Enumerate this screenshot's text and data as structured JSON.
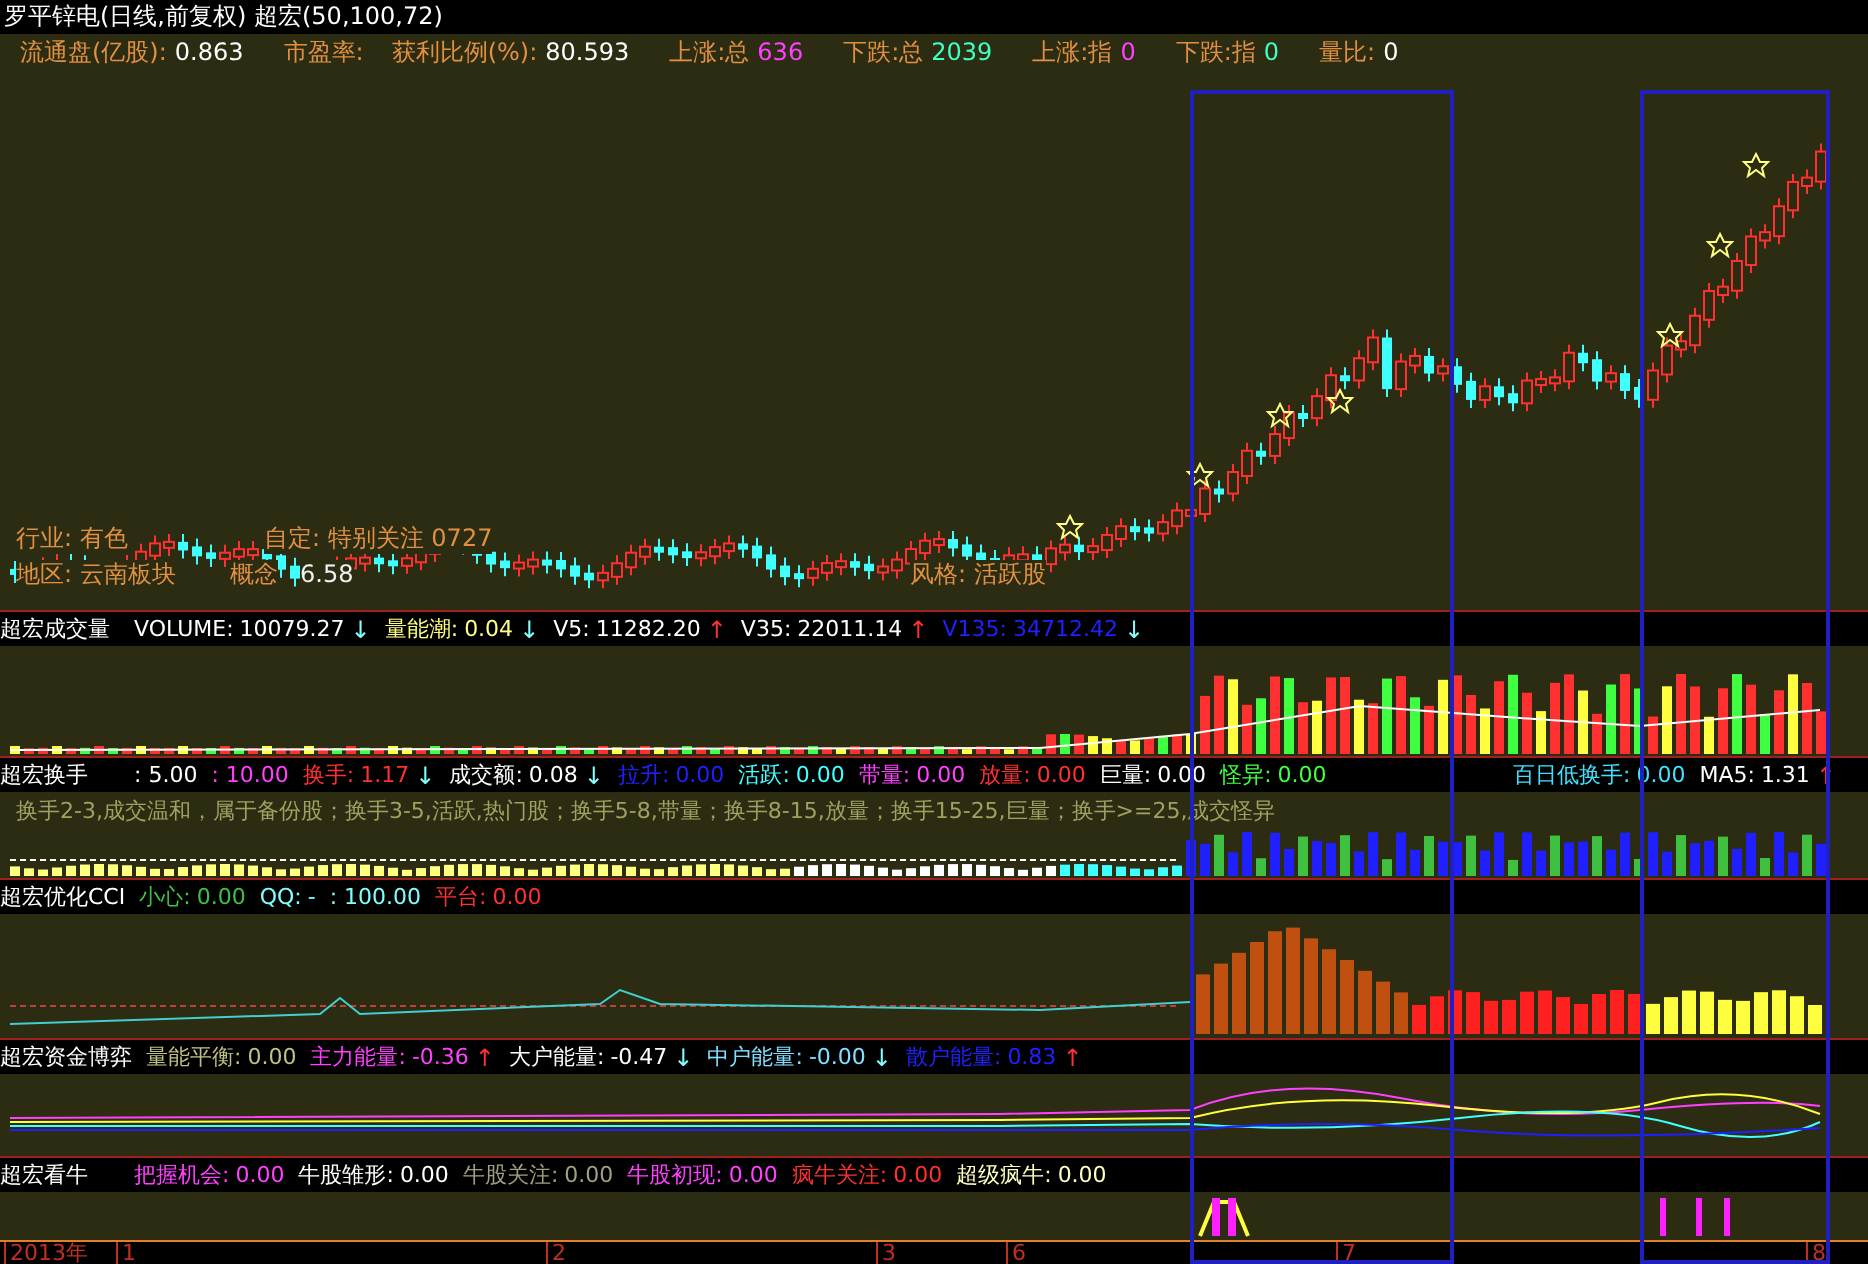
{
  "window": {
    "title": "罗平锌电(日线,前复权) 超宏(50,100,72)"
  },
  "header": [
    {
      "label": "流通盘(亿股):",
      "value": "0.863",
      "color": "#ffffff"
    },
    {
      "label": "市盈率:"
    },
    {
      "label": "获利比例(%):",
      "value": "80.593",
      "color": "#ffffff"
    },
    {
      "label": "上涨:总",
      "value": "636",
      "color": "#ff40ff"
    },
    {
      "label": "下跌:总",
      "value": "2039",
      "color": "#40ffc0"
    },
    {
      "label": "上涨:指",
      "value": "0",
      "color": "#ff40ff"
    },
    {
      "label": "下跌:指",
      "value": "0",
      "color": "#40ffc0"
    },
    {
      "label": "量比:",
      "value": "0",
      "color": "#ffffff"
    }
  ],
  "main_chart": {
    "notes": [
      "行业: 有色",
      "自定: 特别关注 0727",
      "地区: 云南板块",
      "概念",
      "风格: 活跃股"
    ],
    "low_price": "6.58"
  },
  "panels": [
    {
      "kind": "volume",
      "title": "超宏成交量",
      "items": [
        {
          "label": "VOLUME:",
          "value": "10079.27",
          "color": "#ffffff",
          "arrow": "↓",
          "rising": false
        },
        {
          "label": "量能潮:",
          "value": "0.04",
          "color": "#ffff80",
          "arrow": "↓",
          "rising": false
        },
        {
          "label": "V5:",
          "value": "11282.20",
          "color": "#ffffff",
          "arrow": "↑",
          "rising": true
        },
        {
          "label": "V35:",
          "value": "22011.14",
          "color": "#ffffff",
          "arrow": "↑",
          "rising": true
        },
        {
          "label": "V135:",
          "value": "34712.42",
          "color": "#2020ff",
          "arrow": "↓",
          "rising": false
        }
      ]
    },
    {
      "kind": "turnover",
      "title": "超宏换手",
      "items": [
        {
          "value": ": 5.00",
          "color": "#ffffff"
        },
        {
          "value": ": 10.00",
          "color": "#ff40ff"
        },
        {
          "label": "换手:",
          "value": "1.17",
          "color": "#ff3030",
          "arrow": "↓",
          "rising": false
        },
        {
          "label": "成交额:",
          "value": "0.08",
          "color": "#ffffff",
          "arrow": "↓",
          "rising": false
        },
        {
          "label": "拉升:",
          "value": "0.00",
          "color": "#2020ff"
        },
        {
          "label": "活跃:",
          "value": "0.00",
          "color": "#40ffff"
        },
        {
          "label": "带量:",
          "value": "0.00",
          "color": "#ff40ff"
        },
        {
          "label": "放量:",
          "value": "0.00",
          "color": "#ff3030"
        },
        {
          "label": "巨量:",
          "value": "0.00",
          "color": "#ffffff"
        },
        {
          "label": "怪异:",
          "value": "0.00",
          "color": "#40ff40"
        }
      ],
      "right_items": [
        {
          "label": "百日低换手:",
          "value": "0.00",
          "color": "#40e0ff"
        },
        {
          "label": "MA5:",
          "value": "1.31",
          "color": "#ffffff",
          "arrow": "↑",
          "rising": true
        }
      ],
      "note": "换手2-3,成交温和，属于备份股；换手3-5,活跃,热门股；换手5-8,带量；换手8-15,放量；换手15-25,巨量；换手>=25,成交怪异"
    },
    {
      "kind": "cci",
      "title": "超宏优化CCI",
      "items": [
        {
          "label": "小心:",
          "value": "0.00",
          "color": "#40c040"
        },
        {
          "label": "QQ:",
          "value": "-",
          "color": "#80ffff"
        },
        {
          "value": ": 100.00",
          "color": "#80ffff"
        },
        {
          "label": "平台:",
          "value": "0.00",
          "color": "#ff3030"
        }
      ]
    },
    {
      "kind": "capital",
      "title": "超宏资金博弈",
      "items": [
        {
          "label": "量能平衡:",
          "value": "0.00",
          "color": "#c0c080"
        },
        {
          "label": "主力能量:",
          "value": "-0.36",
          "color": "#ff40ff",
          "arrow": "↑",
          "rising": true
        },
        {
          "label": "大户能量:",
          "value": "-0.47",
          "color": "#ffffff",
          "arrow": "↓",
          "rising": false
        },
        {
          "label": "中户能量:",
          "value": "-0.00",
          "color": "#80e0ff",
          "arrow": "↓",
          "rising": false
        },
        {
          "label": "散户能量:",
          "value": "0.83",
          "color": "#2020ff",
          "arrow": "↑",
          "rising": true
        }
      ]
    },
    {
      "kind": "bull",
      "title": "超宏看牛",
      "items": [
        {
          "label": "把握机会:",
          "value": "0.00",
          "color": "#ff40ff"
        },
        {
          "label": "牛股雏形:",
          "value": "0.00",
          "color": "#ffffff"
        },
        {
          "label": "牛股关注:",
          "value": "0.00",
          "color": "#a0a080"
        },
        {
          "label": "牛股初现:",
          "value": "0.00",
          "color": "#ff40ff"
        },
        {
          "label": "疯牛关注:",
          "value": "0.00",
          "color": "#ff3030"
        },
        {
          "label": "超级疯牛:",
          "value": "0.00",
          "color": "#ffffc0"
        }
      ]
    }
  ],
  "axis_labels": [
    "2013年",
    "1",
    "2",
    "3",
    "6",
    "7",
    "8"
  ]
}
